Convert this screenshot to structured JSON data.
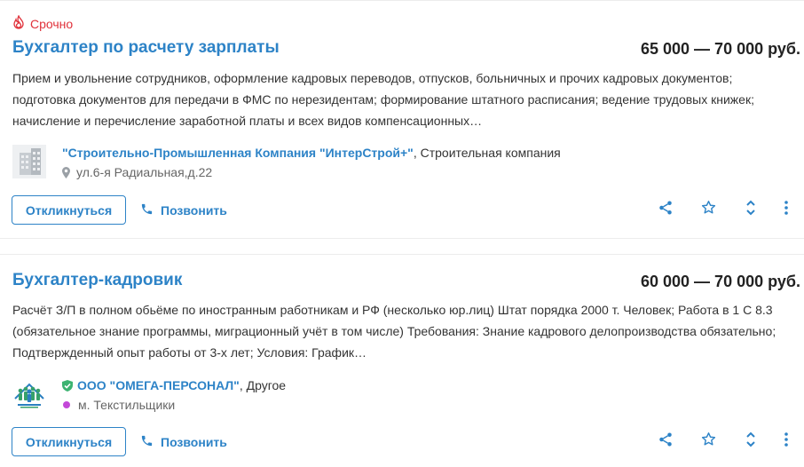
{
  "vacancies": [
    {
      "urgent_label": "Срочно",
      "title": "Бухгалтер по расчету зарплаты",
      "salary": "65 000 — 70 000 руб.",
      "description": "Прием и увольнение сотрудников, оформление кадровых переводов, отпусков, больничных и прочих кадровых документов; подготовка документов для передачи в ФМС по нерезидентам; формирование штатного расписания; ведение трудовых книжек; начисление и перечисление заработной платы и всех видов компенсационных…",
      "company_name": "\"Строительно-Промышленная Компания \"ИнтерСтрой+\"",
      "company_type": ", Строительная компания",
      "address": "ул.6-я Радиальная,д.22",
      "respond_label": "Откликнуться",
      "call_label": "Позвонить"
    },
    {
      "title": "Бухгалтер-кадровик",
      "salary": "60 000 — 70 000 руб.",
      "description": "Расчёт З/П в полном обьёме по иностранным работникам и РФ (несколько юр.лиц) Штат порядка 2000 т. Человек; Работа в 1 С 8.3 (обязательное знание программы, миграционный учёт в том числе) Требования: Знание кадрового делопроизводства обязательно; Подтвержденный опыт работы от 3-х лет; Условия: График…",
      "company_name": "ООО \"ОМЕГА-ПЕРСОНАЛ\"",
      "company_type": ", Другое",
      "address": "м. Текстильщики",
      "respond_label": "Откликнуться",
      "call_label": "Позвонить"
    }
  ],
  "colors": {
    "link": "#2d83c7",
    "urgent": "#e0313a",
    "metro": "#c348d8",
    "verified": "#3cb371"
  },
  "icons": [
    "fire-icon",
    "location-pin-icon",
    "phone-icon",
    "share-icon",
    "star-icon",
    "expand-icon",
    "more-vertical-icon",
    "verified-shield-icon",
    "building-logo-icon",
    "omega-logo-icon"
  ]
}
